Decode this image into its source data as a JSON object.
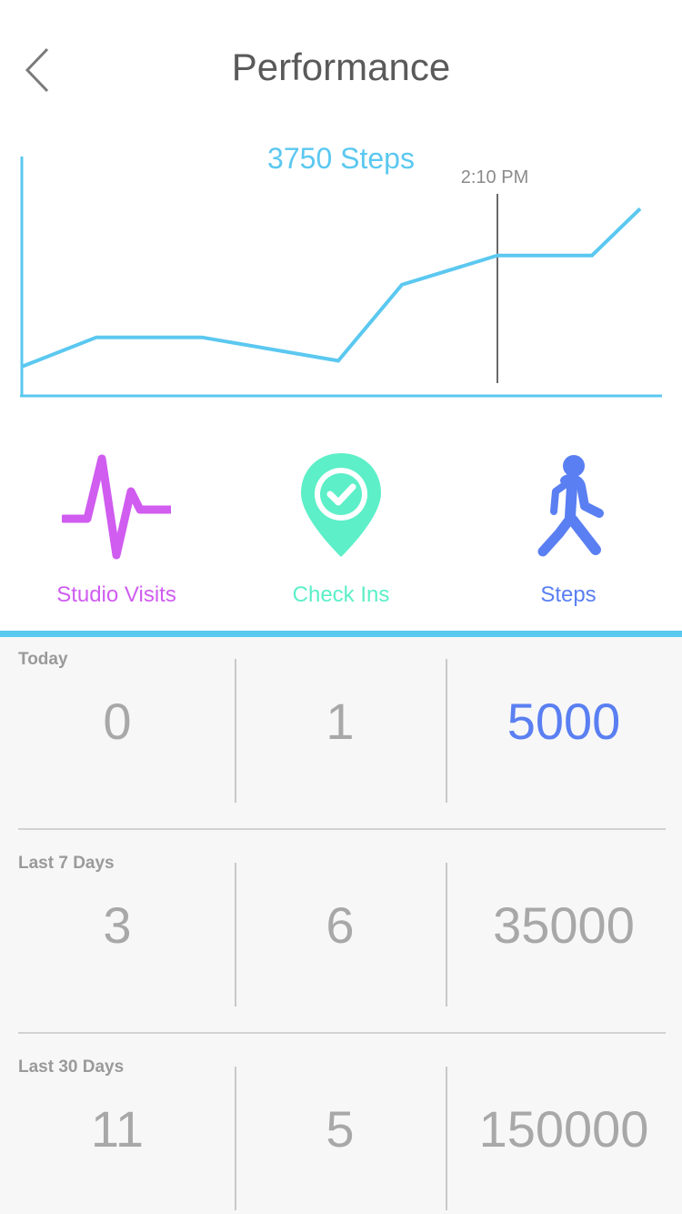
{
  "header": {
    "title": "Performance",
    "back_icon": "chevron-left-icon"
  },
  "chart_data": {
    "type": "line",
    "title": "3750 Steps",
    "marker_label": "2:10 PM",
    "x": [
      0,
      1,
      2,
      3,
      4,
      5,
      6,
      7
    ],
    "values": [
      1,
      2,
      2,
      1.2,
      3.8,
      4.8,
      4.8,
      6.4
    ],
    "ylim": [
      0,
      7
    ],
    "marker_x": 5,
    "color": "#5bc8f0",
    "grid": false
  },
  "categories": [
    {
      "label": "Studio Visits",
      "icon": "heartbeat-icon",
      "color": "#d05cf0"
    },
    {
      "label": "Check Ins",
      "icon": "location-check-icon",
      "color": "#5cefc8"
    },
    {
      "label": "Steps",
      "icon": "walking-person-icon",
      "color": "#5a7ff2"
    }
  ],
  "stats": [
    {
      "label": "Today",
      "values": [
        "0",
        "1",
        "5000"
      ]
    },
    {
      "label": "Last 7 Days",
      "values": [
        "3",
        "6",
        "35000"
      ]
    },
    {
      "label": "Last 30 Days",
      "values": [
        "11",
        "5",
        "150000"
      ]
    }
  ],
  "colors": {
    "accent": "#5bc8f0",
    "highlight": "#5a7ff2"
  }
}
